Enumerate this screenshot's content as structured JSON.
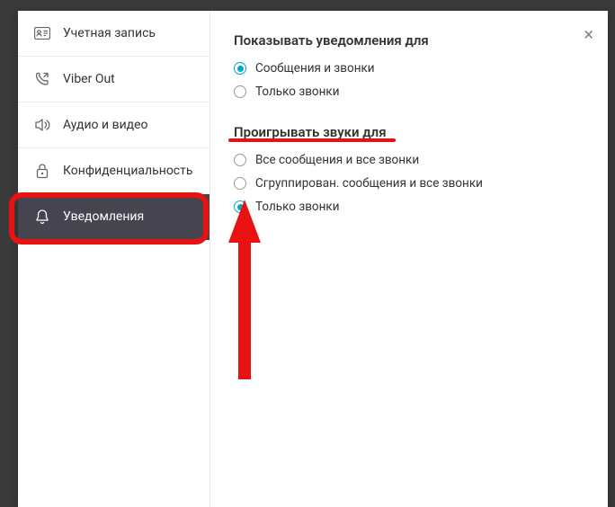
{
  "close_label": "×",
  "sidebar": {
    "items": [
      {
        "label": "Учетная запись",
        "icon": "id-card-icon",
        "active": false
      },
      {
        "label": "Viber Out",
        "icon": "phone-out-icon",
        "active": false
      },
      {
        "label": "Аудио и видео",
        "icon": "speaker-icon",
        "active": false
      },
      {
        "label": "Конфиденциальность",
        "icon": "lock-icon",
        "active": false
      },
      {
        "label": "Уведомления",
        "icon": "bell-icon",
        "active": true
      }
    ]
  },
  "sections": [
    {
      "title": "Показывать уведомления для",
      "options": [
        {
          "label": "Сообщения и звонки",
          "checked": true
        },
        {
          "label": "Только звонки",
          "checked": false
        }
      ]
    },
    {
      "title": "Проигрывать звуки для",
      "options": [
        {
          "label": "Все сообщения и все звонки",
          "checked": false
        },
        {
          "label": "Сгруппирован. сообщения и все звонки",
          "checked": false
        },
        {
          "label": "Только звонки",
          "checked": true
        }
      ]
    }
  ],
  "annotations": {
    "highlight_sidebar_item": 4,
    "underline_section": 1,
    "arrow_target": "sounds_only_calls"
  }
}
